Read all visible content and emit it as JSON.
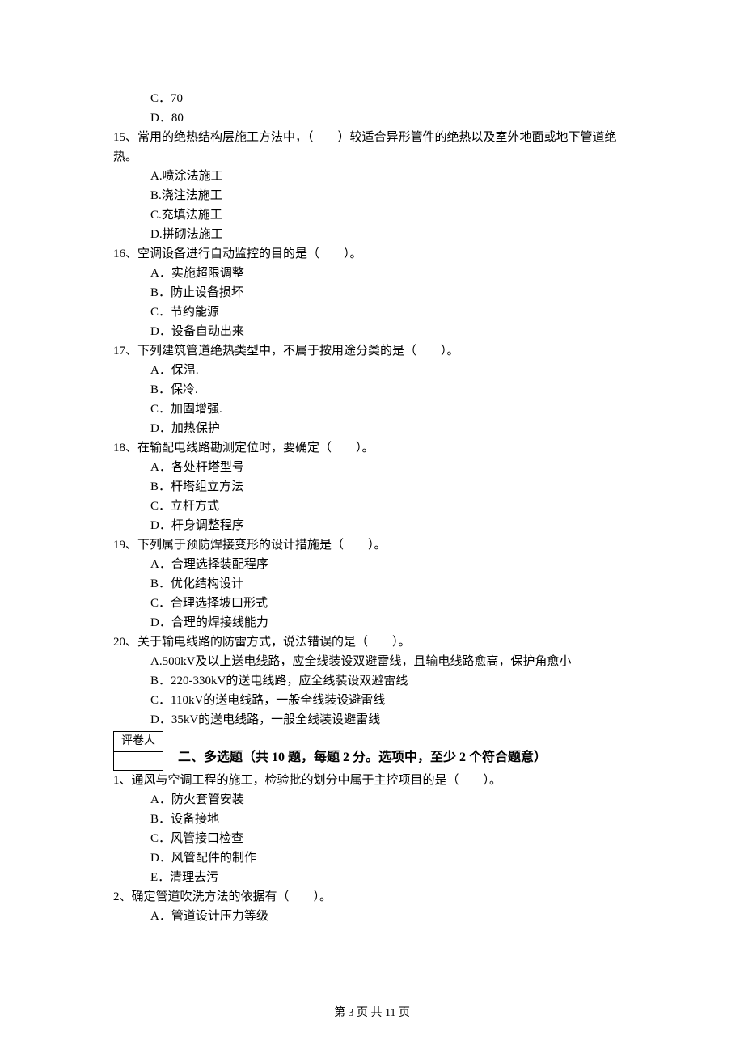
{
  "q14_tail": {
    "options": [
      "C．70",
      "D．80"
    ]
  },
  "q15": {
    "text": "15、常用的绝热结构层施工方法中，（　　）较适合异形管件的绝热以及室外地面或地下管道绝热。",
    "options": [
      "A.喷涂法施工",
      "B.浇注法施工",
      "C.充填法施工",
      "D.拼砌法施工"
    ]
  },
  "q16": {
    "text": "16、空调设备进行自动监控的目的是（　　）。",
    "options": [
      "A．实施超限调整",
      "B．防止设备损坏",
      "C．节约能源",
      "D．设备自动出来"
    ]
  },
  "q17": {
    "text": "17、下列建筑管道绝热类型中，不属于按用途分类的是（　　）。",
    "options": [
      "A．保温.",
      "B．保冷.",
      "C．加固增强.",
      "D．加热保护"
    ]
  },
  "q18": {
    "text": "18、在输配电线路勘测定位时，要确定（　　）。",
    "options": [
      "A．各处杆塔型号",
      "B．杆塔组立方法",
      "C．立杆方式",
      "D．杆身调整程序"
    ]
  },
  "q19": {
    "text": "19、下列属于预防焊接变形的设计措施是（　　）。",
    "options": [
      "A．合理选择装配程序",
      "B．优化结构设计",
      "C．合理选择坡口形式",
      "D．合理的焊接线能力"
    ]
  },
  "q20": {
    "text": "20、关于输电线路的防雷方式，说法错误的是（　　）。",
    "options": [
      "A.500kV及以上送电线路，应全线装设双避雷线，且输电线路愈高，保护角愈小",
      "B．220-330kV的送电线路，应全线装设双避雷线",
      "C．110kV的送电线路，一般全线装设避雷线",
      "D．35kV的送电线路，一般全线装设避雷线"
    ]
  },
  "grader_label": "评卷人",
  "section2_title": "二、多选题（共 10 题，每题 2 分。选项中，至少 2 个符合题意）",
  "mq1": {
    "text": "1、通风与空调工程的施工，检验批的划分中属于主控项目的是（　　）。",
    "options": [
      "A．防火套管安装",
      "B．设备接地",
      "C．风管接口检查",
      "D．风管配件的制作",
      "E．清理去污"
    ]
  },
  "mq2": {
    "text": "2、确定管道吹洗方法的依据有（　　）。",
    "options": [
      "A．管道设计压力等级"
    ]
  },
  "footer": "第 3 页 共 11 页"
}
